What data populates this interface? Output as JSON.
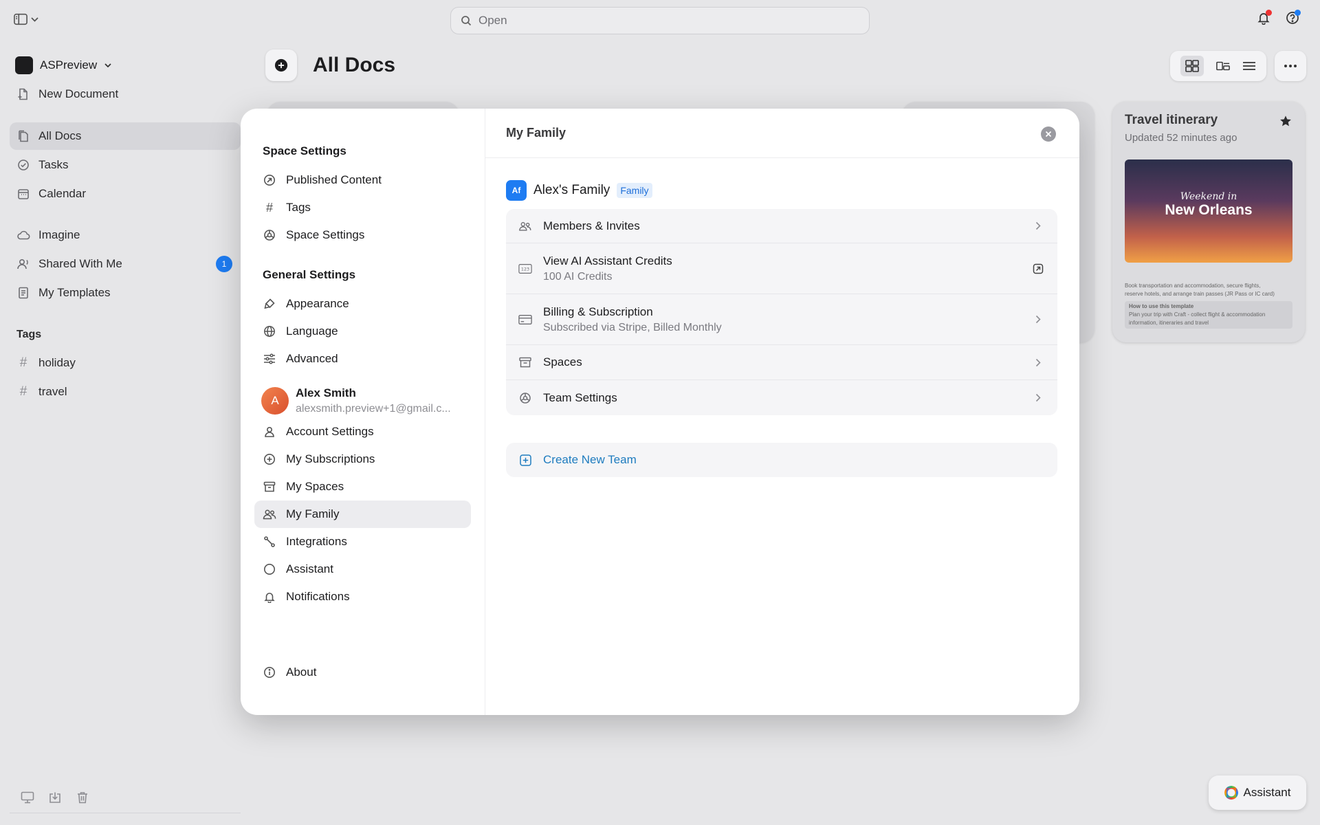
{
  "search": {
    "placeholder": "Open"
  },
  "workspace": {
    "name": "ASPreview"
  },
  "sidebar": {
    "new_document": "New Document",
    "nav": [
      "All Docs",
      "Tasks",
      "Calendar"
    ],
    "secondary": [
      "Imagine",
      "Shared With Me",
      "My Templates"
    ],
    "shared_badge": "1",
    "tags_heading": "Tags",
    "tags": [
      "holiday",
      "travel"
    ]
  },
  "header": {
    "title": "All Docs"
  },
  "card": {
    "title": "Travel itinerary",
    "updated": "Updated 52 minutes ago",
    "image_line1": "Weekend in",
    "image_line2": "New Orleans",
    "line1": "Book transportation and accommodation, secure flights,",
    "line2": "reserve hotels, and arrange train passes (JR Pass or IC card)",
    "line3": "How to use this template",
    "line4": "Plan your trip with Craft - collect flight & accommodation information, itineraries and travel"
  },
  "assistant_button": "Assistant",
  "modal": {
    "space_heading": "Space Settings",
    "space_items": [
      "Published Content",
      "Tags",
      "Space Settings"
    ],
    "general_heading": "General Settings",
    "general_items": [
      "Appearance",
      "Language",
      "Advanced"
    ],
    "user": {
      "initial": "A",
      "name": "Alex Smith",
      "email": "alexsmith.preview+1@gmail.c..."
    },
    "account_items": [
      "Account Settings",
      "My Subscriptions",
      "My Spaces",
      "My Family",
      "Integrations",
      "Assistant",
      "Notifications"
    ],
    "about": "About",
    "panel_title": "My Family",
    "team": {
      "initials": "Af",
      "name": "Alex's Family",
      "tag": "Family"
    },
    "rows": [
      {
        "label": "Members & Invites",
        "sub": ""
      },
      {
        "label": "View AI Assistant Credits",
        "sub": "100 AI Credits"
      },
      {
        "label": "Billing & Subscription",
        "sub": "Subscribed via Stripe, Billed Monthly"
      },
      {
        "label": "Spaces",
        "sub": ""
      },
      {
        "label": "Team Settings",
        "sub": ""
      }
    ],
    "create_team": "Create New Team"
  },
  "colors": {
    "accent": "#1e7cf2",
    "link": "#1e7cbf",
    "badge_bg": "#1e7cf2"
  }
}
